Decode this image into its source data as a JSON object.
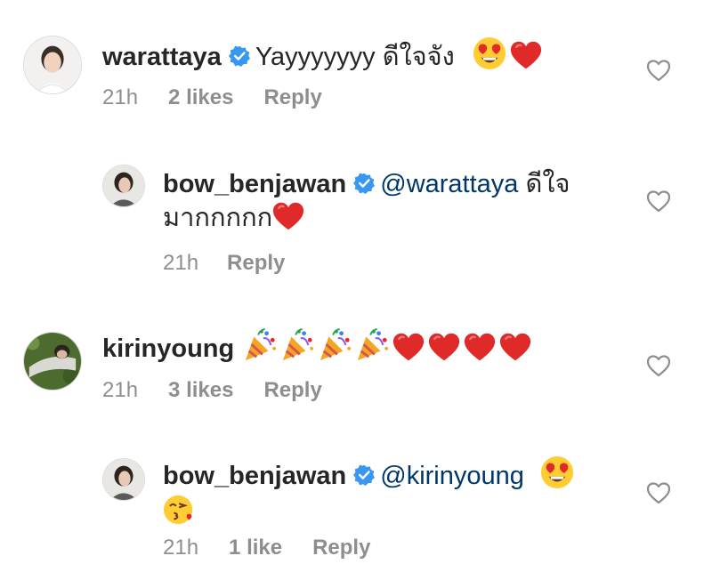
{
  "comments": [
    {
      "username": "warattaya",
      "mention": "",
      "text": "Yayyyyyyy ดีใจจัง",
      "emojis": [
        "heart-eyes-emoji",
        "red-heart-emoji"
      ],
      "time": "21h",
      "likes": "2 likes",
      "reply": "Reply"
    },
    {
      "username": "bow_benjawan",
      "mention": "@warattaya",
      "text": "ดีใจ",
      "text2": "มากกกกก",
      "emojis": [
        "red-heart-emoji"
      ],
      "time": "21h",
      "likes": "",
      "reply": "Reply"
    },
    {
      "username": "kirinyoung",
      "mention": "",
      "text": "",
      "emojis": [
        "party-popper-emoji",
        "party-popper-emoji",
        "party-popper-emoji",
        "party-popper-emoji",
        "red-heart-emoji",
        "red-heart-emoji",
        "red-heart-emoji",
        "red-heart-emoji"
      ],
      "time": "21h",
      "likes": "3 likes",
      "reply": "Reply"
    },
    {
      "username": "bow_benjawan",
      "mention": "@kirinyoung",
      "text": "",
      "emojis": [
        "heart-eyes-emoji",
        "kissing-emoji"
      ],
      "time": "21h",
      "likes": "1 like",
      "reply": "Reply"
    }
  ],
  "colors": {
    "mention": "#00376b",
    "verified": "#3897f0",
    "meta": "#8e8e8e",
    "heart": "#ed4956"
  }
}
